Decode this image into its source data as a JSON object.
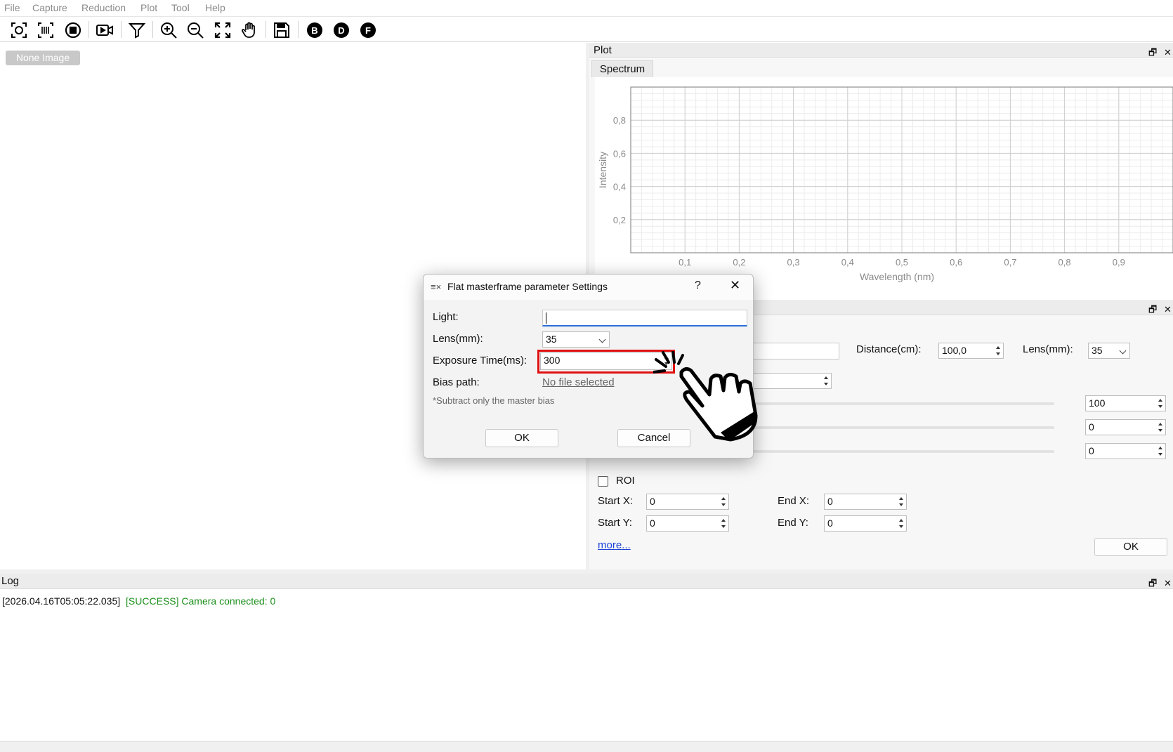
{
  "menu": [
    "File",
    "Capture",
    "Reduction",
    "Plot",
    "Tool",
    "Help"
  ],
  "toolbar": {
    "icons": [
      "screenshot-icon",
      "barcode-scan-icon",
      "stop-icon",
      "video-icon",
      "filter-icon",
      "zoom-in-icon",
      "zoom-out-icon",
      "fit-screen-icon",
      "hand-pan-icon",
      "save-icon"
    ],
    "letters": [
      "B",
      "D",
      "F"
    ]
  },
  "image_area": {
    "status": "None Image"
  },
  "plot_dock": {
    "title": "Plot",
    "tab": "Spectrum"
  },
  "chart_data": {
    "type": "line",
    "title": "",
    "xlabel": "Wavelength (nm)",
    "ylabel": "Intensity",
    "xlim": [
      0,
      1
    ],
    "ylim": [
      0,
      1
    ],
    "xticks": [
      "0,1",
      "0,2",
      "0,3",
      "0,4",
      "0,5",
      "0,6",
      "0,7",
      "0,8",
      "0,9"
    ],
    "yticks": [
      "0,2",
      "0,4",
      "0,6",
      "0,8"
    ],
    "grid": true,
    "series": []
  },
  "settings": {
    "distance_label": "Distance(cm):",
    "distance_value": "100,0",
    "lens_label": "Lens(mm):",
    "lens_value": "35",
    "slider_values": [
      "100",
      "0",
      "0"
    ],
    "roi_label": "ROI",
    "start_x_label": "Start X:",
    "start_x": "0",
    "end_x_label": "End X:",
    "end_x": "0",
    "start_y_label": "Start Y:",
    "start_y": "0",
    "end_y_label": "End Y:",
    "end_y": "0",
    "more_link": "more...",
    "ok": "OK"
  },
  "log": {
    "title": "Log",
    "entries": [
      {
        "time": "[2026.04.16T05:05:22.035]",
        "message": "[SUCCESS] Camera connected: 0"
      }
    ]
  },
  "dialog": {
    "title": "Flat masterframe parameter Settings",
    "help": "?",
    "light_label": "Light:",
    "light_value": "",
    "lens_label": "Lens(mm):",
    "lens_value": "35",
    "exposure_label": "Exposure Time(ms):",
    "exposure_value": "300",
    "bias_label": "Bias path:",
    "bias_value": "No file selected",
    "note": "*Subtract only the master bias",
    "ok": "OK",
    "cancel": "Cancel"
  },
  "colors": {
    "highlight": "#e01010",
    "success": "#1a8f1a",
    "link": "#1a3fd6"
  }
}
